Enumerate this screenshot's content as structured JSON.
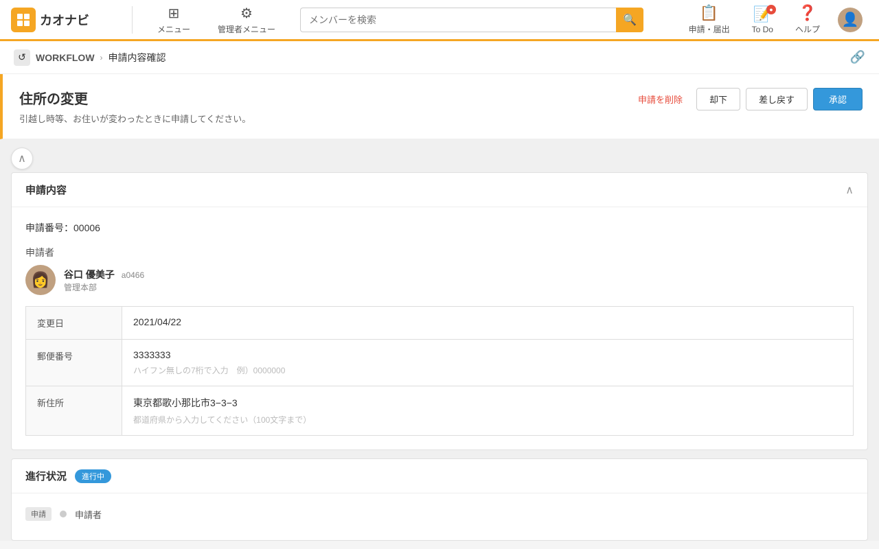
{
  "header": {
    "logo_text": "カオナビ",
    "menu_label": "メニュー",
    "admin_menu_label": "管理者メニュー",
    "search_placeholder": "メンバーを検索",
    "search_icon": "🔍",
    "applications_label": "申請・届出",
    "todo_label": "To Do",
    "help_label": "ヘルプ",
    "todo_badge": "●",
    "menu_icon": "⊞",
    "gear_icon": "⚙",
    "bell_icon": "📋",
    "todo_icon": "📋",
    "help_icon": "❓"
  },
  "breadcrumb": {
    "icon": "↺",
    "section": "WORKFLOW",
    "separator": "›",
    "current": "申請内容確認",
    "link_icon": "🔗"
  },
  "page": {
    "title": "住所の変更",
    "subtitle": "引越し時等、お住いが変わったときに申請してください。",
    "btn_delete": "申請を削除",
    "btn_reject": "却下",
    "btn_return": "差し戻す",
    "btn_approve": "承認"
  },
  "application_section": {
    "title": "申請内容",
    "toggle_icon": "∧",
    "request_number_label": "申請番号：",
    "request_number": "00006",
    "applicant_label": "申請者",
    "applicant_name": "谷口 優美子",
    "applicant_id": "a0466",
    "applicant_dept": "管理本部",
    "fields": [
      {
        "label": "変更日",
        "value": "2021/04/22",
        "hint": ""
      },
      {
        "label": "郵便番号",
        "value": "3333333",
        "hint": "ハイフン無しの7桁で入力　例）0000000"
      },
      {
        "label": "新住所",
        "value": "東京都歌小那比市3−3−3",
        "hint": "都道府県から入力してください（100文字まで）"
      }
    ]
  },
  "progress_section": {
    "title": "進行状況",
    "status": "進行中",
    "step_label": "申請",
    "step_name": "申請者"
  }
}
